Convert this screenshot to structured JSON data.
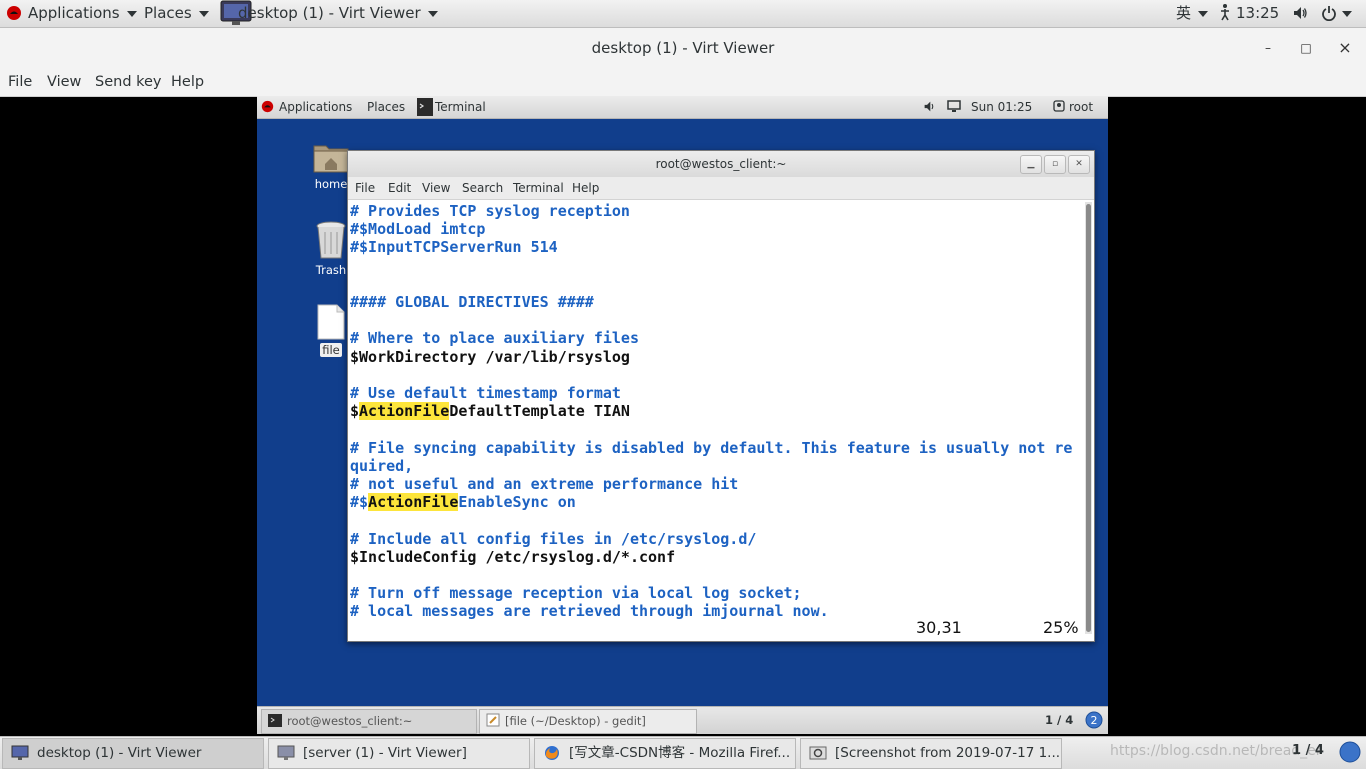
{
  "host_panel": {
    "applications": "Applications",
    "places": "Places",
    "window_title": "desktop (1) - Virt Viewer",
    "input_method": "英",
    "clock": "13:25"
  },
  "viewer": {
    "title": "desktop (1) - Virt Viewer",
    "menu": [
      "File",
      "View",
      "Send key",
      "Help"
    ],
    "minimize": "–",
    "maximize": "□",
    "close": "×"
  },
  "guest_panel": {
    "applications": "Applications",
    "places": "Places",
    "app": "Terminal",
    "clock": "Sun 01:25",
    "user": "root"
  },
  "desktop_icons": {
    "home": "home",
    "trash": "Trash",
    "file": "file"
  },
  "terminal": {
    "title": "root@westos_client:~",
    "menu": [
      "File",
      "Edit",
      "View",
      "Search",
      "Terminal",
      "Help"
    ],
    "lines": [
      "# Provides TCP syslog reception",
      "#$ModLoad imtcp",
      "#$InputTCPServerRun 514",
      "",
      "",
      "#### GLOBAL DIRECTIVES ####",
      "",
      "# Where to place auxiliary files",
      "$WorkDirectory /var/lib/rsyslog",
      "",
      "# Use default timestamp format",
      "$ActionFileDefaultTemplate TIAN",
      "",
      "# File syncing capability is disabled by default. This feature is usually not re",
      "quired,",
      "# not useful and an extreme performance hit",
      "#$ActionFileEnableSync on",
      "",
      "# Include all config files in /etc/rsyslog.d/",
      "$IncludeConfig /etc/rsyslog.d/*.conf",
      "",
      "# Turn off message reception via local log socket;",
      "# local messages are retrieved through imjournal now."
    ],
    "highlight": "ActionFile",
    "cursor_pos": "30,31",
    "scroll_percent": "25%"
  },
  "guest_taskbar": {
    "items": [
      "root@westos_client:~",
      "[file (~/Desktop) - gedit]"
    ],
    "workspace": "1 / 4"
  },
  "host_taskbar": {
    "items": [
      "desktop (1) - Virt Viewer",
      "[server (1) - Virt Viewer]",
      "[写文章-CSDN博客 - Mozilla Firef...",
      "[Screenshot from 2019-07-17 1..."
    ],
    "watermark": "https://blog.csdn.net/bread_er",
    "workspace": "1 / 4"
  },
  "colors": {
    "guest_desktop": "#113e8c",
    "comment": "#1d62c2",
    "highlight": "#fde53b"
  }
}
